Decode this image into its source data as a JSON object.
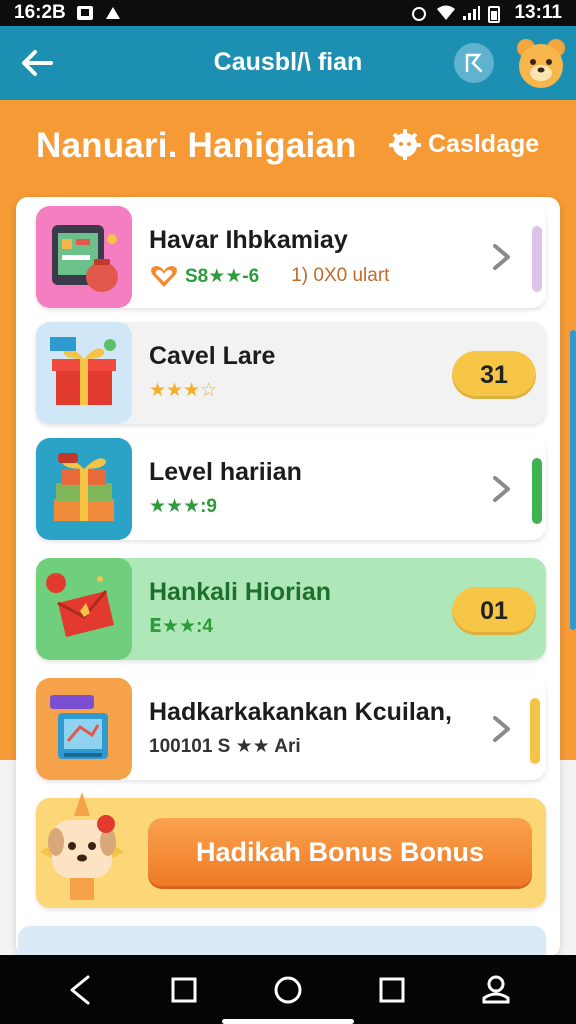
{
  "status_bar": {
    "time_left": "16:2B",
    "time_right": "13:11"
  },
  "app_bar": {
    "title": "Causbl/\\ fian"
  },
  "header": {
    "title": "Nanuari. Hanigaian",
    "action_label": "Casldage"
  },
  "items": [
    {
      "title": "Havar Ihbkamiay",
      "meta": "S8★★-6",
      "extra": "1) 0X0 ulart",
      "trailing": "chevron",
      "accent": "#d9b8e6",
      "bg": "#ffffff"
    },
    {
      "title": "Cavel Lare",
      "meta": "★★★☆",
      "trailing": "badge",
      "badge": "31",
      "bg": "#f2f2f2"
    },
    {
      "title": "Level hariian",
      "meta": "★★★:9",
      "trailing": "chevron",
      "accent": "#3fb34f",
      "bg": "#ffffff"
    },
    {
      "title": "Hankali Hiorian",
      "meta": "ⴹ★★:4",
      "trailing": "badge",
      "badge": "01",
      "bg": "#aee8b8"
    },
    {
      "title": "Hadkarkakankan Kcuilan,",
      "meta": "100101 S ★★ Ari",
      "trailing": "chevron",
      "accent": "#f6c445",
      "bg": "#ffffff"
    }
  ],
  "promo": {
    "button_label": "Hadikah Bonus Bonus"
  },
  "colors": {
    "app_bar": "#1d8fb3",
    "orange": "#f69a36",
    "green_text": "#2e9b3d",
    "badge": "#f7c646"
  }
}
